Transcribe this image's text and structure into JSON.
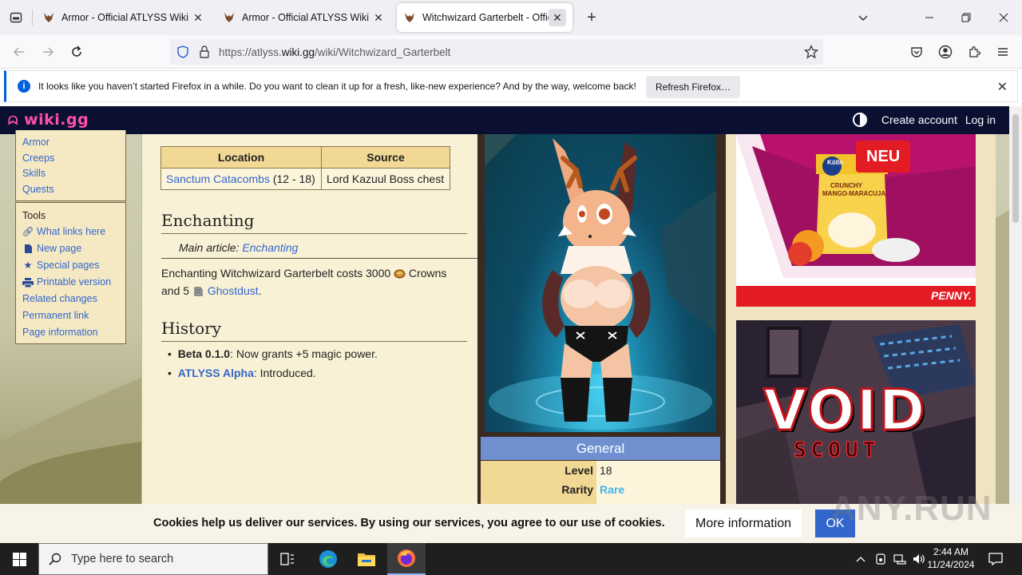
{
  "browser": {
    "tabs": [
      {
        "title": "Armor - Official ATLYSS Wiki",
        "active": false
      },
      {
        "title": "Armor - Official ATLYSS Wiki",
        "active": false
      },
      {
        "title": "Witchwizard Garterbelt - Offici",
        "active": true
      }
    ],
    "url_prefix": "https://atlyss.",
    "url_domain": "wiki.gg",
    "url_path": "/wiki/Witchwizard_Garterbelt",
    "notification": {
      "message": "It looks like you haven’t started Firefox in a while. Do you want to clean it up for a fresh, like-new experience? And by the way, welcome back!",
      "button": "Refresh Firefox…"
    }
  },
  "wiki": {
    "logo": "wiki.gg",
    "create_account": "Create account",
    "log_in": "Log in",
    "sidebar_nav": [
      "Armor",
      "Creeps",
      "Skills",
      "Quests"
    ],
    "tools_title": "Tools",
    "tools": [
      {
        "label": "What links here",
        "icon": "link-icon"
      },
      {
        "label": "New page",
        "icon": "new-page-icon"
      },
      {
        "label": "Special pages",
        "icon": "star-icon"
      },
      {
        "label": "Printable version",
        "icon": "printer-icon"
      },
      {
        "label": "Related changes",
        "icon": ""
      },
      {
        "label": "Permanent link",
        "icon": ""
      },
      {
        "label": "Page information",
        "icon": ""
      }
    ],
    "location_table": {
      "headers": [
        "Location",
        "Source"
      ],
      "location_link": "Sanctum Catacombs",
      "location_levels": "(12 - 18)",
      "source": "Lord Kazuul Boss chest"
    },
    "enchanting": {
      "heading": "Enchanting",
      "main_article_label": "Main article:",
      "main_article_link": "Enchanting",
      "text_1": "Enchanting Witchwizard Garterbelt costs 3000",
      "crowns": "Crowns",
      "and": "and 5",
      "ghostdust": "Ghostdust",
      "period": "."
    },
    "history": {
      "heading": "History",
      "items": [
        {
          "bold": "Beta 0.1.0",
          "text": ": Now grants +5 magic power."
        },
        {
          "link": "ATLYSS Alpha",
          "text": ": Introduced."
        }
      ]
    },
    "infobox": {
      "section": "General",
      "level_label": "Level",
      "level_value": "18",
      "rarity_label": "Rarity",
      "rarity_value": "Rare",
      "rarity_color": "#3fb6ef"
    },
    "ads": {
      "ad1_badge": "NEU",
      "ad1_brand": "PENNY.",
      "ad1_product": "Kölln",
      "ad1_product_line1": "CRUNCHY",
      "ad1_product_line2": "MANGO-MARACUJA",
      "ad2_title": "VOID",
      "ad2_subtitle": "SCOUT"
    }
  },
  "cookie": {
    "text": "Cookies help us deliver our services. By using our services, you agree to our use of cookies.",
    "more": "More information",
    "ok": "OK"
  },
  "watermark": "ANY.RUN",
  "taskbar": {
    "search_placeholder": "Type here to search",
    "time": "2:44 AM",
    "date": "11/24/2024"
  }
}
